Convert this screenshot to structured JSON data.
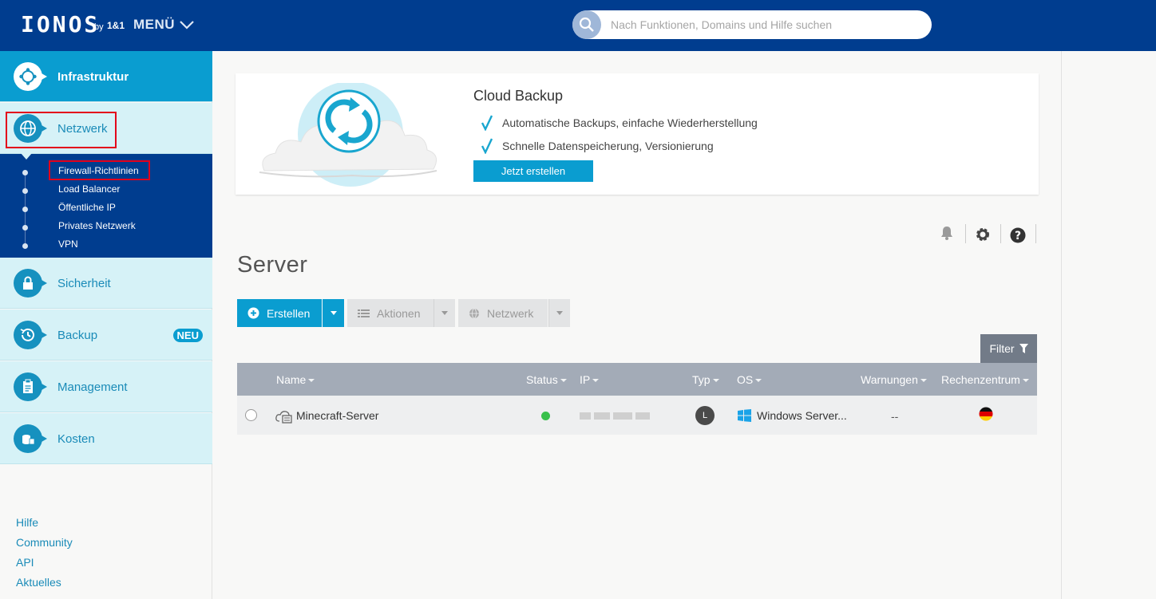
{
  "header": {
    "logo": "IONOS",
    "logo_by": "by",
    "logo_brand": "1&1",
    "menu_label": "MENÜ",
    "search_placeholder": "Nach Funktionen, Domains und Hilfe suchen"
  },
  "sidebar": {
    "items": [
      {
        "label": "Infrastruktur"
      },
      {
        "label": "Netzwerk"
      },
      {
        "label": "Sicherheit"
      },
      {
        "label": "Backup",
        "badge": "NEU"
      },
      {
        "label": "Management"
      },
      {
        "label": "Kosten"
      }
    ],
    "subitems": [
      {
        "label": "Firewall-Richtlinien"
      },
      {
        "label": "Load Balancer"
      },
      {
        "label": "Öffentliche IP"
      },
      {
        "label": "Privates Netzwerk"
      },
      {
        "label": "VPN"
      }
    ],
    "links": [
      {
        "label": "Hilfe"
      },
      {
        "label": "Community"
      },
      {
        "label": "API"
      },
      {
        "label": "Aktuelles"
      }
    ]
  },
  "promo": {
    "title": "Cloud Backup",
    "lines": [
      "Automatische Backups, einfache Wiederherstellung",
      "Schnelle Datenspeicherung, Versionierung"
    ],
    "button": "Jetzt erstellen"
  },
  "page": {
    "title": "Server"
  },
  "toolbar": {
    "create": "Erstellen",
    "actions": "Aktionen",
    "network": "Netzwerk",
    "filter": "Filter"
  },
  "table": {
    "columns": [
      "Name",
      "Status",
      "IP",
      "Typ",
      "OS",
      "Warnungen",
      "Rechenzentrum"
    ],
    "rows": [
      {
        "name": "Minecraft-Server",
        "typ": "L",
        "os": "Windows Server...",
        "warnings": "--"
      }
    ]
  },
  "colors": {
    "header": "#003d8f",
    "accent": "#0a9dd0",
    "status_ok": "#39c04b"
  }
}
